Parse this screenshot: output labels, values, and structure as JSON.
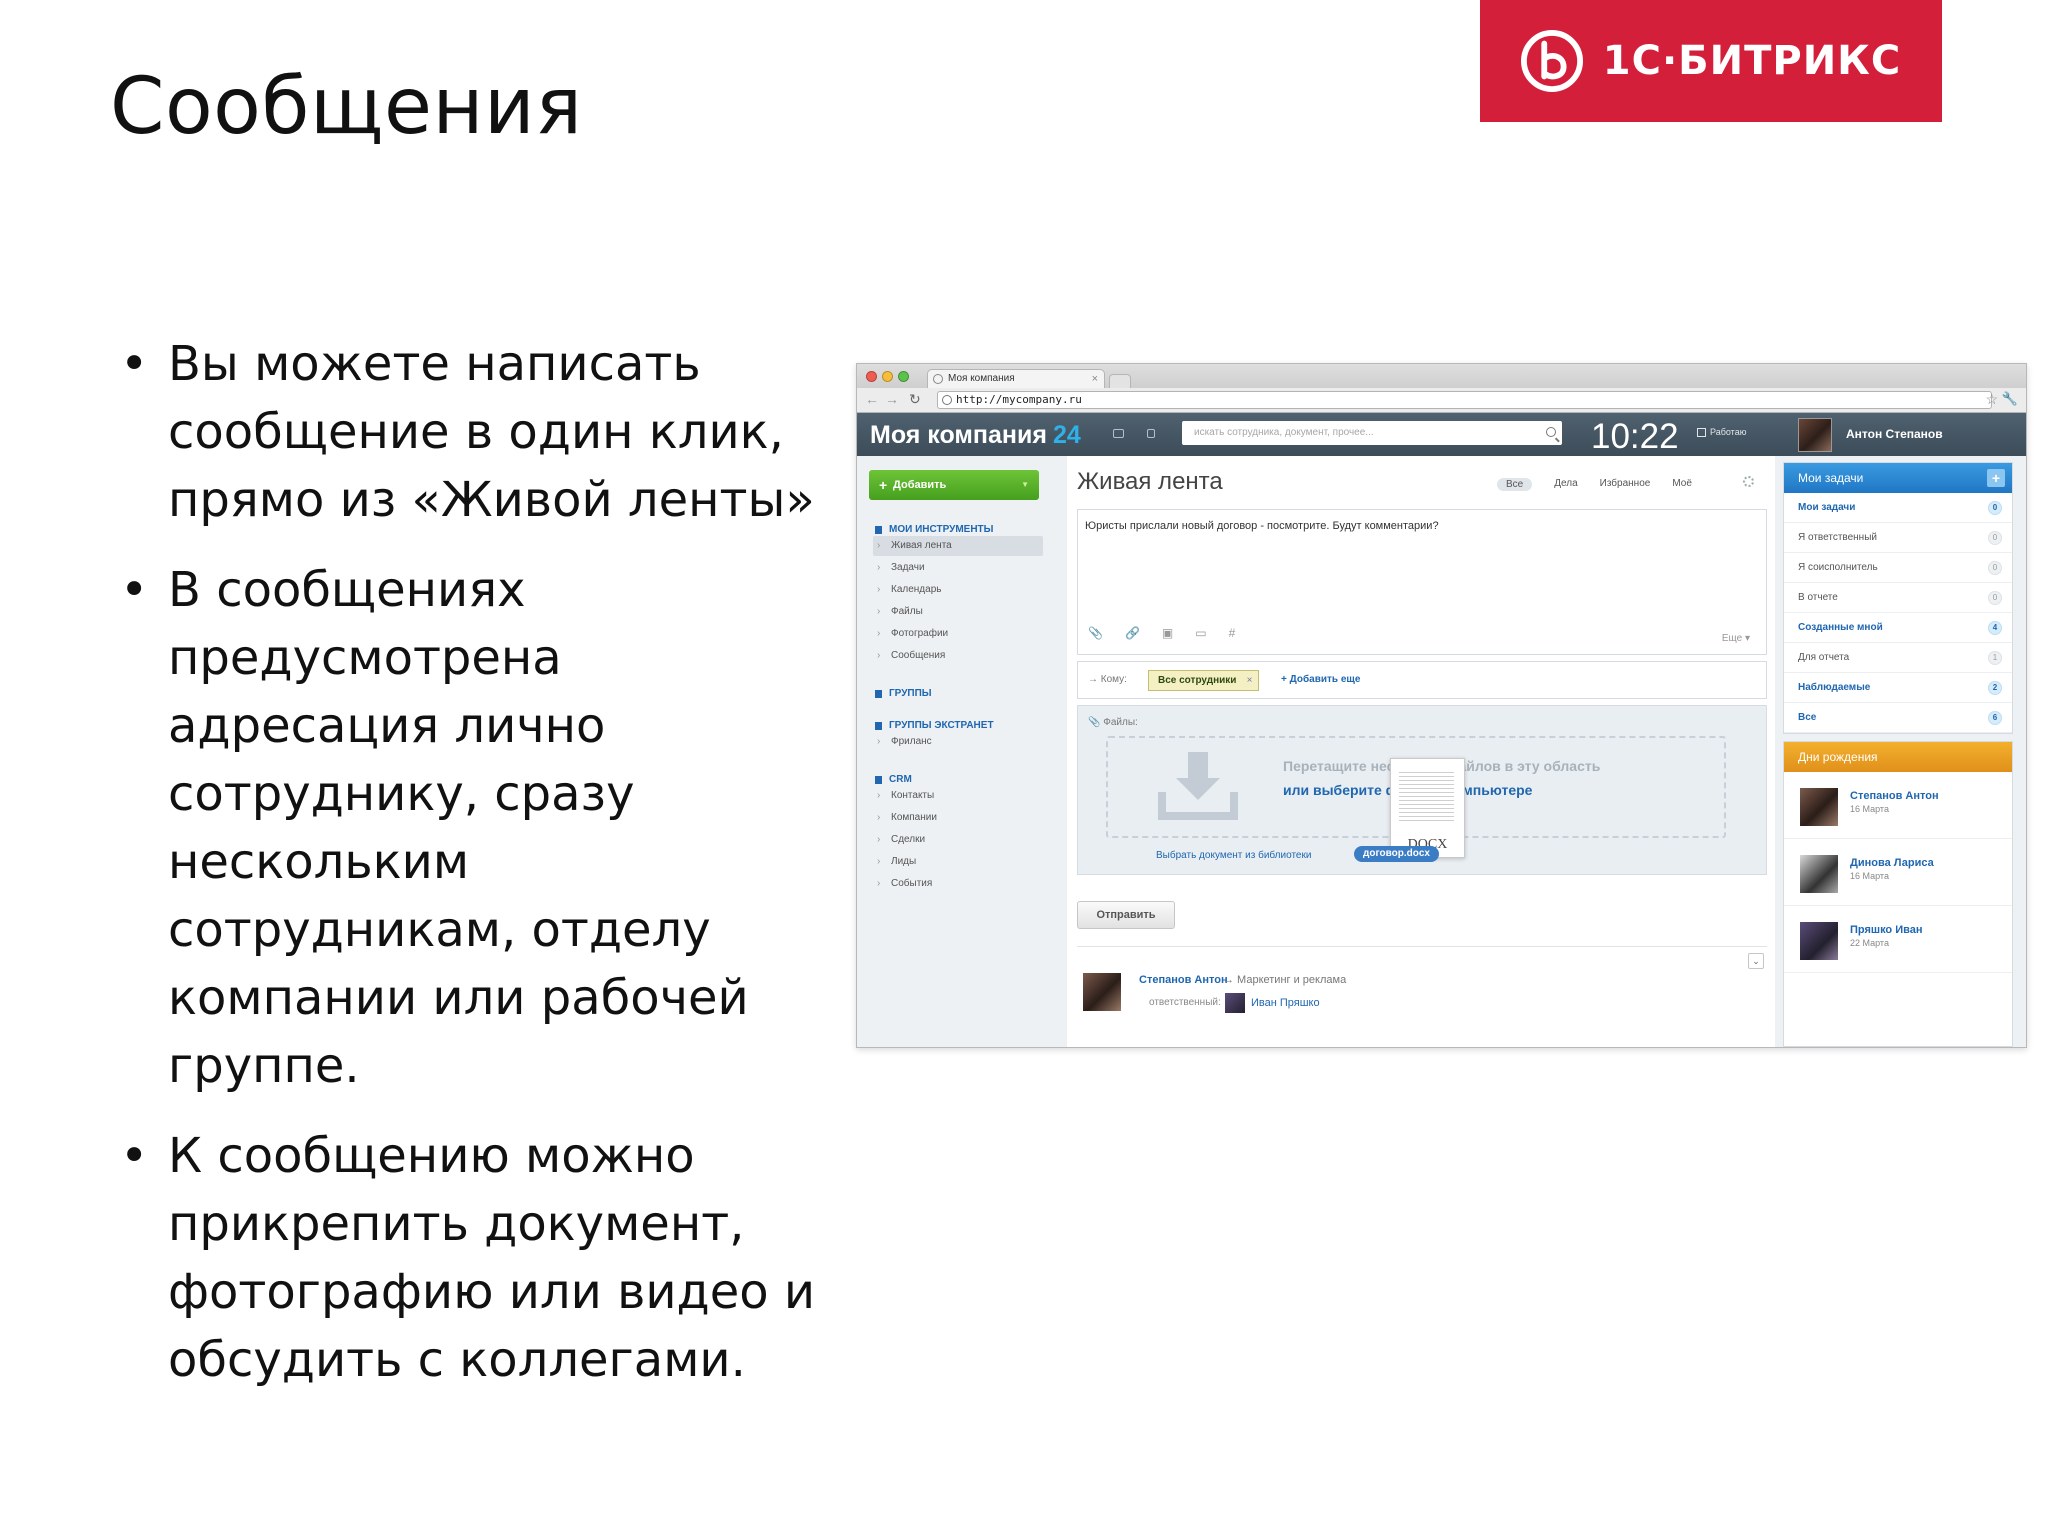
{
  "slide": {
    "title": "Сообщения",
    "logo_text": "1С·БИТРИКС",
    "bullets": [
      "Вы можете написать сообщение в один клик, прямо из «Живой ленты»",
      "В сообщениях предусмотрена адресация лично сотруднику, сразу нескольким сотрудникам, отделу компании или рабочей группе.",
      "К сообщению можно прикрепить документ, фотографию или видео и обсудить с коллегами."
    ]
  },
  "browser": {
    "tab_title": "Моя компания",
    "tab_close": "×",
    "url": "http://mycompany.ru"
  },
  "header": {
    "brand": "Моя компания",
    "brand_num": "24",
    "search_placeholder": "искать сотрудника, документ, прочее...",
    "clock": "10:22",
    "status": "Работаю",
    "user": "Антон Степанов"
  },
  "leftnav": {
    "add_button": "Добавить",
    "sections": [
      {
        "label": "МОИ ИНСТРУМЕНТЫ",
        "items": [
          "Живая лента",
          "Задачи",
          "Календарь",
          "Файлы",
          "Фотографии",
          "Сообщения"
        ]
      },
      {
        "label": "ГРУППЫ",
        "items": []
      },
      {
        "label": "ГРУППЫ ЭКСТРАНЕТ",
        "items": [
          "Фриланс"
        ]
      },
      {
        "label": "CRM",
        "items": [
          "Контакты",
          "Компании",
          "Сделки",
          "Лиды",
          "События"
        ]
      }
    ]
  },
  "main": {
    "title": "Живая лента",
    "filters": [
      "Все",
      "Дела",
      "Избранное",
      "Моё"
    ],
    "composer_text": "Юристы прислали новый договор - посмотрите. Будут комментарии?",
    "more": "Еще",
    "to_label": "Кому:",
    "recipient": "Все сотрудники",
    "recipient_remove": "×",
    "add_more": "+ Добавить еще",
    "files_label": "Файлы:",
    "drop_text_1": "Перетащите несколько файлов в эту область",
    "drop_text_2": "или выберите файл на компьютере",
    "doc_ext": "DOCX",
    "library_link": "Выбрать документ из библиотеки",
    "attached_file": "договор.docx",
    "send_button": "Отправить",
    "post": {
      "author": "Степанов Антон",
      "target": "→ Маркетинг и реклама",
      "responsible_label": "ответственный:",
      "responsible": "Иван Пряшко"
    }
  },
  "tasks": {
    "title": "Мои задачи",
    "rows": [
      {
        "label": "Мои задачи",
        "count": "0",
        "bold": true
      },
      {
        "label": "Я ответственный",
        "count": "0",
        "bold": false
      },
      {
        "label": "Я соисполнитель",
        "count": "0",
        "bold": false
      },
      {
        "label": "В отчете",
        "count": "0",
        "bold": false
      },
      {
        "label": "Созданные мной",
        "count": "4",
        "bold": true
      },
      {
        "label": "Для отчета",
        "count": "1",
        "bold": false
      },
      {
        "label": "Наблюдаемые",
        "count": "2",
        "bold": true
      },
      {
        "label": "Все",
        "count": "6",
        "bold": true
      }
    ]
  },
  "birthdays": {
    "title": "Дни рождения",
    "people": [
      {
        "name": "Степанов Антон",
        "date": "16 Марта"
      },
      {
        "name": "Динова Лариса",
        "date": "16 Марта"
      },
      {
        "name": "Пряшко Иван",
        "date": "22 Марта"
      }
    ]
  },
  "counters": {
    "messages": "0",
    "notifications": "0"
  },
  "colors": {
    "logo_red": "#d41f3a",
    "add_green": "#46a01f",
    "link_blue": "#2067b0",
    "tasks_blue": "#2077c4",
    "bday_orange": "#e0901a"
  }
}
